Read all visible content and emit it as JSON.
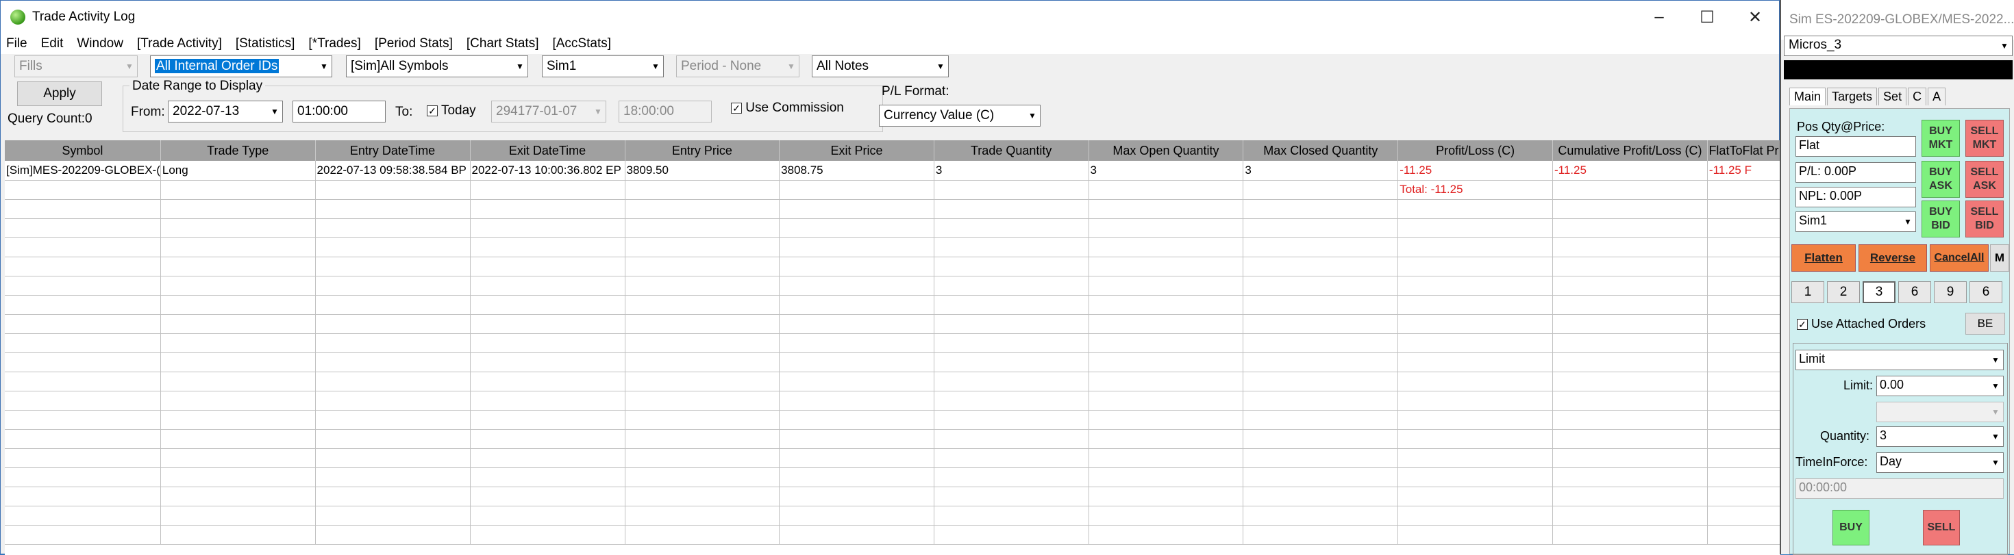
{
  "window": {
    "title": "Trade Activity Log"
  },
  "menu": [
    "File",
    "Edit",
    "Window",
    "[Trade Activity]",
    "[Statistics]",
    "[*Trades]",
    "[Period Stats]",
    "[Chart Stats]",
    "[AccStats]"
  ],
  "filters": {
    "fills": "Fills",
    "order_ids": "All Internal Order IDs",
    "symbols": "[Sim]All Symbols",
    "account": "Sim1",
    "period": "Period - None",
    "notes": "All Notes",
    "apply": "Apply",
    "query_count": "Query Count:0",
    "date_range_legend": "Date Range to Display",
    "from_label": "From:",
    "from_date": "2022-07-13",
    "from_time": "01:00:00",
    "to_label": "To:",
    "today_label": "Today",
    "today_checked": true,
    "to_date": "294177-01-07",
    "to_time": "18:00:00",
    "use_commission_label": "Use Commission",
    "use_commission_checked": true,
    "pl_format_label": "P/L Format:",
    "pl_format": "Currency Value (C)"
  },
  "table": {
    "columns": [
      "Symbol",
      "Trade Type",
      "Entry DateTime",
      "Exit DateTime",
      "Entry Price",
      "Exit Price",
      "Trade Quantity",
      "Max Open Quantity",
      "Max Closed Quantity",
      "Profit/Loss (C)",
      "Cumulative Profit/Loss (C)",
      "FlatToFlat Pr"
    ],
    "rows": [
      [
        "[Sim]MES-202209-GLOBEX-(",
        "Long",
        "2022-07-13  09:58:38.584 BP",
        "2022-07-13  10:00:36.802 EP",
        "3809.50",
        "3808.75",
        "3",
        "3",
        "3",
        "-11.25",
        "-11.25",
        "-11.25 F"
      ],
      [
        "",
        "",
        "",
        "",
        "",
        "",
        "",
        "",
        "",
        "Total: -11.25",
        "",
        ""
      ]
    ]
  },
  "panel": {
    "title": "Sim ES-202209-GLOBEX/MES-2022...",
    "account_group": "Micros_3",
    "tabs": [
      "Main",
      "Targets",
      "Set",
      "C",
      "A"
    ],
    "pos_label": "Pos Qty@Price:",
    "pos_value": "Flat",
    "pl_value": "P/L: 0.00P",
    "npl_value": "NPL: 0.00P",
    "account": "Sim1",
    "buy_mkt": "BUY MKT",
    "sell_mkt": "SELL MKT",
    "buy_ask": "BUY ASK",
    "sell_ask": "SELL ASK",
    "buy_bid": "BUY BID",
    "sell_bid": "SELL BID",
    "flatten": "Flatten",
    "reverse": "Reverse",
    "cancel_all": "CancelAll",
    "m": "M",
    "qty_buttons": [
      "1",
      "2",
      "3",
      "6",
      "9",
      "6"
    ],
    "use_attached_orders": "Use Attached Orders",
    "be": "BE",
    "order_type": "Limit",
    "limit_label": "Limit:",
    "limit_value": "0.00",
    "quantity_label": "Quantity:",
    "quantity_value": "3",
    "tif_label": "TimeInForce:",
    "tif_value": "Day",
    "time_value": "00:00:00",
    "buy": "BUY",
    "sell": "SELL"
  }
}
